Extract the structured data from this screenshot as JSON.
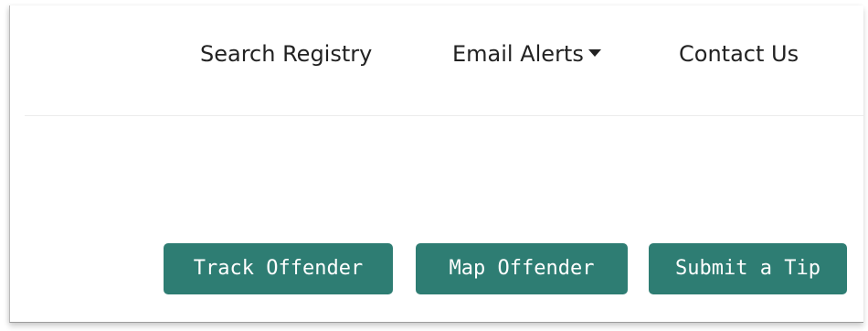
{
  "nav": {
    "search_registry": "Search Registry",
    "email_alerts": "Email Alerts",
    "contact_us": "Contact Us"
  },
  "actions": {
    "track_offender": "Track Offender",
    "map_offender": "Map Offender",
    "submit_tip": "Submit a Tip"
  },
  "colors": {
    "button_bg": "#2e7d73",
    "button_text": "#ffffff",
    "nav_text": "#222222"
  },
  "icons": {
    "email_alerts_dropdown": "caret-down-icon"
  }
}
